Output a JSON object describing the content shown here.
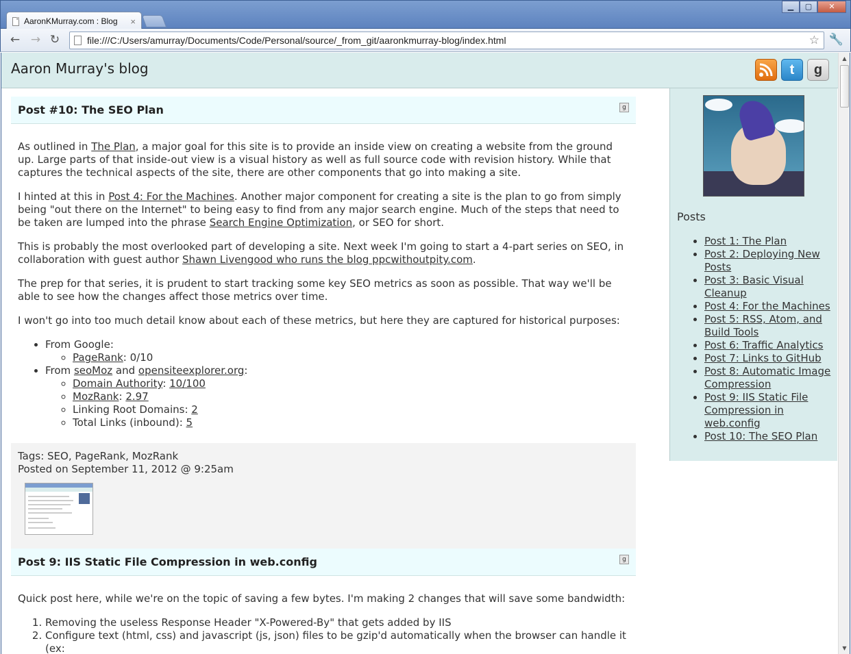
{
  "browser": {
    "tab_title": "AaronKMurray.com : Blog",
    "url": "file:///C:/Users/amurray/Documents/Code/Personal/source/_from_git/aaronkmurray-blog/index.html"
  },
  "site": {
    "title": "Aaron Murray's blog"
  },
  "posts": [
    {
      "title": "Post #10: The SEO Plan",
      "p1_pre": "As outlined in ",
      "p1_link": "The Plan",
      "p1_post": ", a major goal for this site is to provide an inside view on creating a website from the ground up. Large parts of that inside-out view is a visual history as well as full source code with revision history. While that captures the technical aspects of the site, there are other components that go into making a site.",
      "p2_pre": "I hinted at this in ",
      "p2_link": "Post 4: For the Machines",
      "p2_mid": ". Another major component for creating a site is the plan to go from simply being \"out there on the Internet\" to being easy to find from any major search engine. Much of the steps that need to be taken are lumped into the phrase ",
      "p2_link2": "Search Engine Optimization",
      "p2_post": ", or SEO for short.",
      "p3_pre": "This is probably the most overlooked part of developing a site. Next week I'm going to start a 4-part series on SEO, in collaboration with guest author ",
      "p3_link": "Shawn Livengood who runs the blog ppcwithoutpity.com",
      "p3_post": ".",
      "p4": "The prep for that series, it is prudent to start tracking some key SEO metrics as soon as possible. That way we'll be able to see how the changes affect those metrics over time.",
      "p5": "I won't go into too much detail know about each of these metrics, but here they are captured for historical purposes:",
      "google_label": "From Google:",
      "pagerank_link": "PageRank",
      "pagerank_value": ": 0/10",
      "from": "From ",
      "seomoz_link": "seoMoz",
      "and": " and ",
      "ose_link": "opensiteexplorer.org",
      "colon": ":",
      "da_link": "Domain Authority",
      "da_sep": ": ",
      "da_value": "10/100",
      "mr_link": "MozRank",
      "mr_sep": ": ",
      "mr_value": "2.97",
      "lrd_label": "Linking Root Domains: ",
      "lrd_value": "2",
      "tl_label": "Total Links (inbound): ",
      "tl_value": "5",
      "tags": "Tags: SEO, PageRank, MozRank",
      "posted": "Posted on September 11, 2012 @ 9:25am"
    },
    {
      "title": "Post 9: IIS Static File Compression in web.config",
      "p1": "Quick post here, while we're on the topic of saving a few bytes. I'm making 2 changes that will save some bandwidth:",
      "li1": "Removing the useless Response Header \"X-Powered-By\" that gets added by IIS",
      "li2": "Configure text (html, css) and javascript (js, json) files to be gzip'd automatically when the browser can handle it (ex:"
    }
  ],
  "sidebar": {
    "posts_label": "Posts",
    "items": [
      "Post 1: The Plan",
      "Post 2: Deploying New Posts",
      "Post 3: Basic Visual Cleanup",
      "Post 4: For the Machines",
      "Post 5: RSS, Atom, and Build Tools",
      "Post 6: Traffic Analytics",
      "Post 7: Links to GitHub",
      "Post 8: Automatic Image Compression",
      "Post 9: IIS Static File Compression in web.config",
      "Post 10: The SEO Plan"
    ]
  },
  "icons": {
    "rss": "rss-icon",
    "twitter": "twitter-icon",
    "github": "github-icon",
    "twitter_glyph": "t",
    "github_glyph": "g",
    "gbtn_glyph": "g"
  },
  "colors": {
    "header_bg": "#d9ecec",
    "post_head_bg": "#ecfcfe",
    "footer_bg": "#f3f3f3"
  }
}
